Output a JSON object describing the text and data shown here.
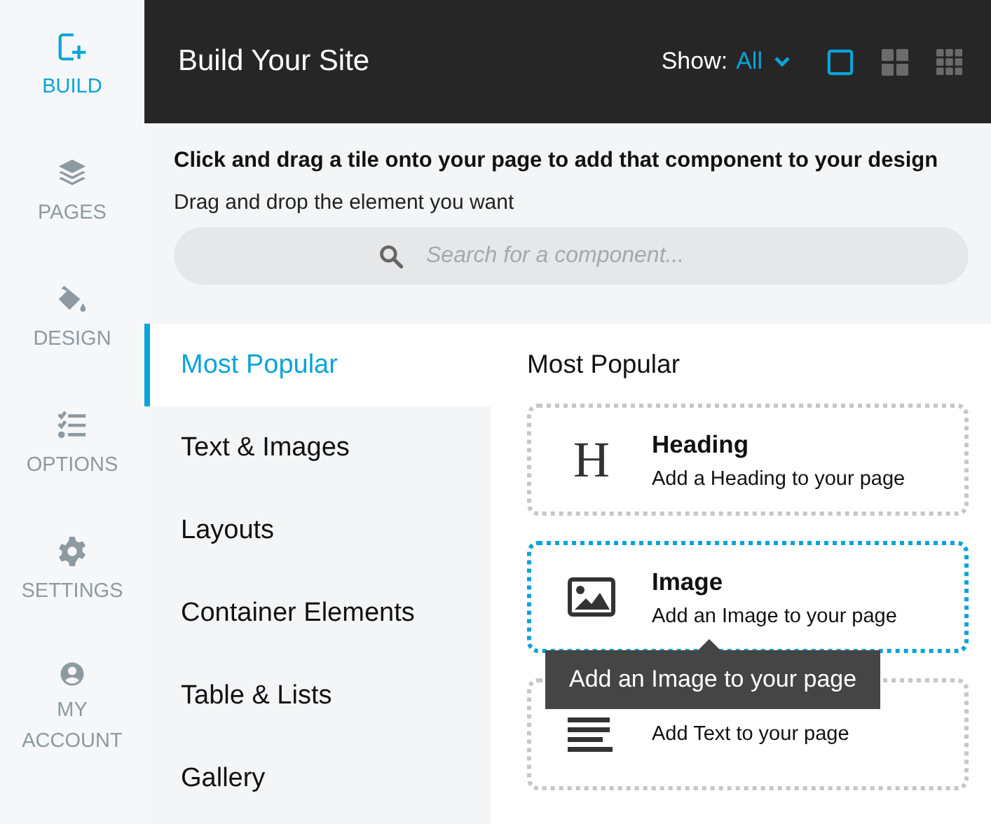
{
  "nav": [
    {
      "label": "BUILD",
      "kind": "build",
      "selected": true
    },
    {
      "label": "PAGES",
      "kind": "pages",
      "selected": false
    },
    {
      "label": "DESIGN",
      "kind": "design",
      "selected": false
    },
    {
      "label": "OPTIONS",
      "kind": "options",
      "selected": false
    },
    {
      "label": "SETTINGS",
      "kind": "settings",
      "selected": false
    },
    {
      "label": "MY ACCOUNT",
      "kind": "account",
      "selected": false
    }
  ],
  "header": {
    "title": "Build Your Site",
    "show_label": "Show:",
    "show_value": "All",
    "views": [
      {
        "kind": "single",
        "selected": true
      },
      {
        "kind": "four",
        "selected": false
      },
      {
        "kind": "nine",
        "selected": false
      }
    ]
  },
  "intro": {
    "heading": "Click and drag a tile onto your page to add that component to your design",
    "subtext": "Drag and drop the element you want",
    "search": {
      "placeholder": "Search for a component..."
    }
  },
  "categories": [
    {
      "label": "Most Popular",
      "selected": true
    },
    {
      "label": "Text & Images",
      "selected": false
    },
    {
      "label": "Layouts",
      "selected": false
    },
    {
      "label": "Container Elements",
      "selected": false
    },
    {
      "label": "Table & Lists",
      "selected": false
    },
    {
      "label": "Gallery",
      "selected": false
    }
  ],
  "section_title": "Most Popular",
  "tiles": [
    {
      "kind": "heading",
      "glyph": "H",
      "title": "Heading",
      "description": "Add a Heading to your page",
      "selected": false
    },
    {
      "kind": "image",
      "title": "Image",
      "description": "Add an Image to your page",
      "selected": true
    },
    {
      "kind": "text",
      "description": "Add Text to your page",
      "selected": false
    }
  ],
  "tooltip": "Add an Image to your page"
}
